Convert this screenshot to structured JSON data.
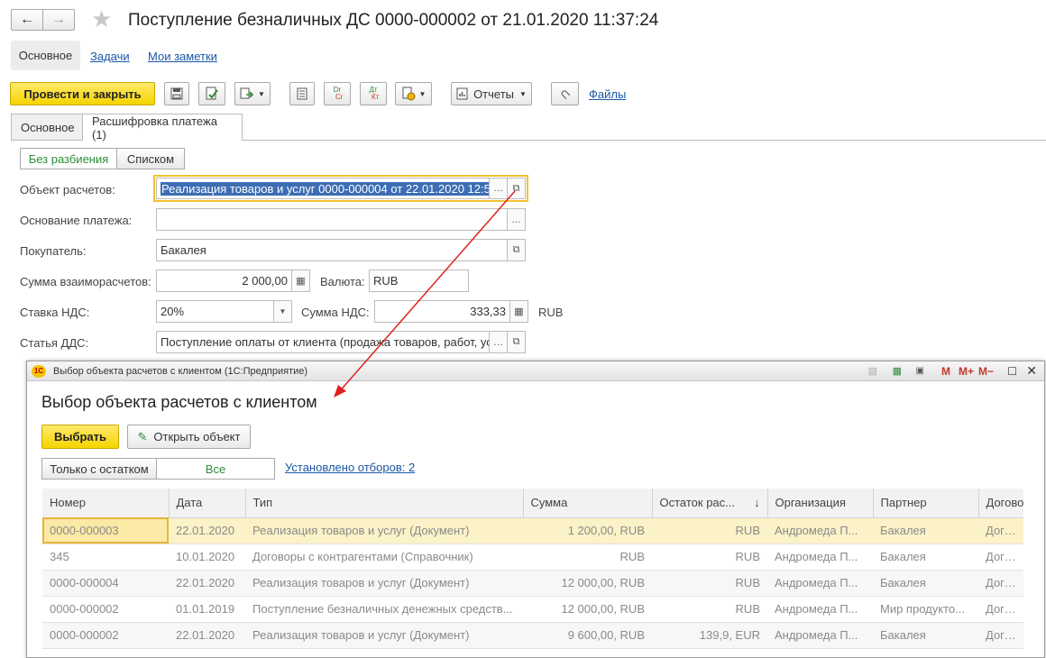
{
  "window": {
    "title": "Поступление безналичных ДС 0000-000002 от 21.01.2020 11:37:24"
  },
  "nav_tabs": [
    "Основное",
    "Задачи",
    "Мои заметки"
  ],
  "toolbar": {
    "post_close": "Провести и закрыть",
    "reports": "Отчеты",
    "files": "Файлы",
    "dt_kt": "Дт Кт",
    "dr_cr": "Dr Cr"
  },
  "form_tabs": [
    "Основное",
    "Расшифровка платежа (1)"
  ],
  "mode_buttons": [
    "Без разбиения",
    "Списком"
  ],
  "fields": {
    "object_label": "Объект расчетов:",
    "object_value": "Реализация товаров и услуг 0000-000004 от 22.01.2020 12:5",
    "basis_label": "Основание платежа:",
    "basis_value": "",
    "buyer_label": "Покупатель:",
    "buyer_value": "Бакалея",
    "sum_label": "Сумма взаиморасчетов:",
    "sum_value": "2 000,00",
    "currency_label": "Валюта:",
    "currency_value": "RUB",
    "vat_rate_label": "Ставка НДС:",
    "vat_rate_value": "20%",
    "vat_sum_label": "Сумма НДС:",
    "vat_sum_value": "333,33",
    "vat_currency": "RUB",
    "dds_label": "Статья ДДС:",
    "dds_value": "Поступление оплаты от клиента (продажа товаров, работ, ус"
  },
  "dialog": {
    "window_title": "Выбор объекта расчетов с клиентом  (1С:Предприятие)",
    "heading": "Выбор объекта расчетов с клиентом",
    "select_button": "Выбрать",
    "open_button": "Открыть объект",
    "filter_only_balance": "Только с остатком",
    "filter_all": "Все",
    "filters_link": "Установлено отборов: 2",
    "title_buttons": [
      "M",
      "M+",
      "M−"
    ],
    "columns": [
      "Номер",
      "Дата",
      "Тип",
      "Сумма",
      "Остаток рас...",
      "Организация",
      "Партнер",
      "Догово"
    ],
    "rows": [
      [
        "0000-000003",
        "22.01.2020",
        "Реализация товаров и услуг (Документ)",
        "1 200,00, RUB",
        "RUB",
        "Андромеда П...",
        "Бакалея",
        "Догово"
      ],
      [
        "345",
        "10.01.2020",
        "Договоры с контрагентами (Справочник)",
        "RUB",
        "RUB",
        "Андромеда П...",
        "Бакалея",
        "Догово"
      ],
      [
        "0000-000004",
        "22.01.2020",
        "Реализация товаров и услуг (Документ)",
        "12 000,00, RUB",
        "RUB",
        "Андромеда П...",
        "Бакалея",
        "Догово"
      ],
      [
        "0000-000002",
        "01.01.2019",
        "Поступление безналичных денежных средств...",
        "12 000,00, RUB",
        "RUB",
        "Андромеда П...",
        "Мир продукто...",
        "Догово"
      ],
      [
        "0000-000002",
        "22.01.2020",
        "Реализация товаров и услуг (Документ)",
        "9 600,00, RUB",
        "139,9, EUR",
        "Андромеда П...",
        "Бакалея",
        "Догово"
      ]
    ]
  },
  "colors": {
    "accent_yellow": "#f5d400",
    "link_blue": "#1b57a6",
    "green_text": "#2e8b3a",
    "arrow_red": "#e02020"
  }
}
